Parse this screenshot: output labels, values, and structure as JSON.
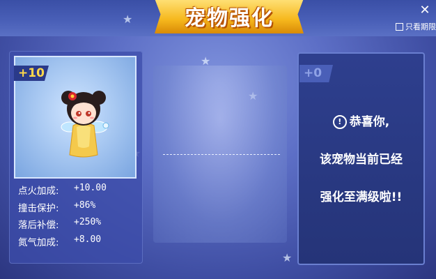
{
  "window": {
    "title": "宠物强化",
    "close_label": "✕",
    "expiry_filter_label": "只看期限"
  },
  "pet": {
    "level": "+10"
  },
  "stats": [
    {
      "name": "点火加成:",
      "value": "+10.00"
    },
    {
      "name": "撞击保护:",
      "value": "+86%"
    },
    {
      "name": "落后补偿:",
      "value": "+250%"
    },
    {
      "name": "氮气加成:",
      "value": "+8.00"
    }
  ],
  "result": {
    "level": "+0",
    "line1": "恭喜你,",
    "line2": "该宠物当前已经",
    "line3": "强化至满级啦!!"
  },
  "colors": {
    "accent_gold": "#f6b81d",
    "level_text": "#ffd84a"
  }
}
